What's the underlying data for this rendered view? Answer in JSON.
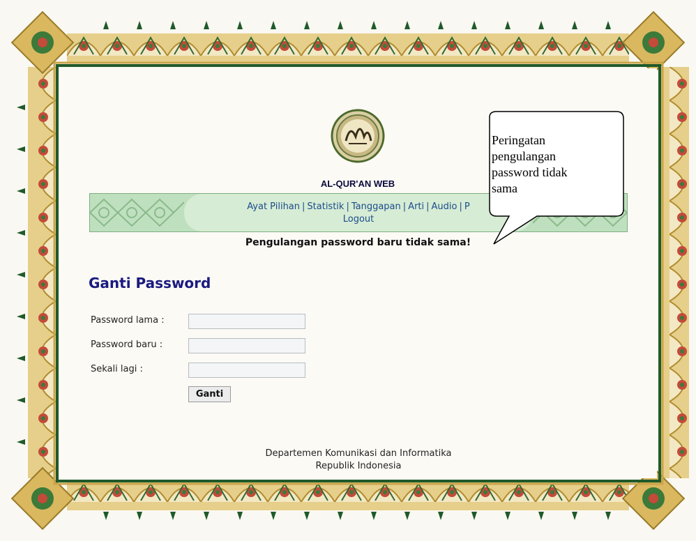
{
  "site": {
    "title": "AL-QUR'AN WEB",
    "logo_icon": "quran-calligraphy-seal-icon"
  },
  "nav": {
    "line1": [
      "Ayat Pilihan",
      "Statistik",
      "Tanggapan",
      "Arti",
      "Audio",
      "P"
    ],
    "separator": "|",
    "line2": "Logout"
  },
  "error_message": "Pengulangan password baru tidak sama!",
  "form": {
    "heading": "Ganti Password",
    "fields": [
      {
        "label": "Password lama :",
        "value": ""
      },
      {
        "label": "Password baru :",
        "value": ""
      },
      {
        "label": "Sekali lagi :",
        "value": ""
      }
    ],
    "submit_label": "Ganti"
  },
  "footer": {
    "line1": "Departemen Komunikasi dan Informatika",
    "line2": "Republik Indonesia"
  },
  "callout": {
    "text_lines": [
      "Peringatan",
      "pengulangan",
      "password tidak",
      "sama"
    ]
  },
  "colors": {
    "frame_gold": "#caa44a",
    "frame_green": "#1f5a2a",
    "nav_green": "#bfe0bf",
    "link_blue": "#1c4c8c",
    "heading_blue": "#1a1a80"
  }
}
